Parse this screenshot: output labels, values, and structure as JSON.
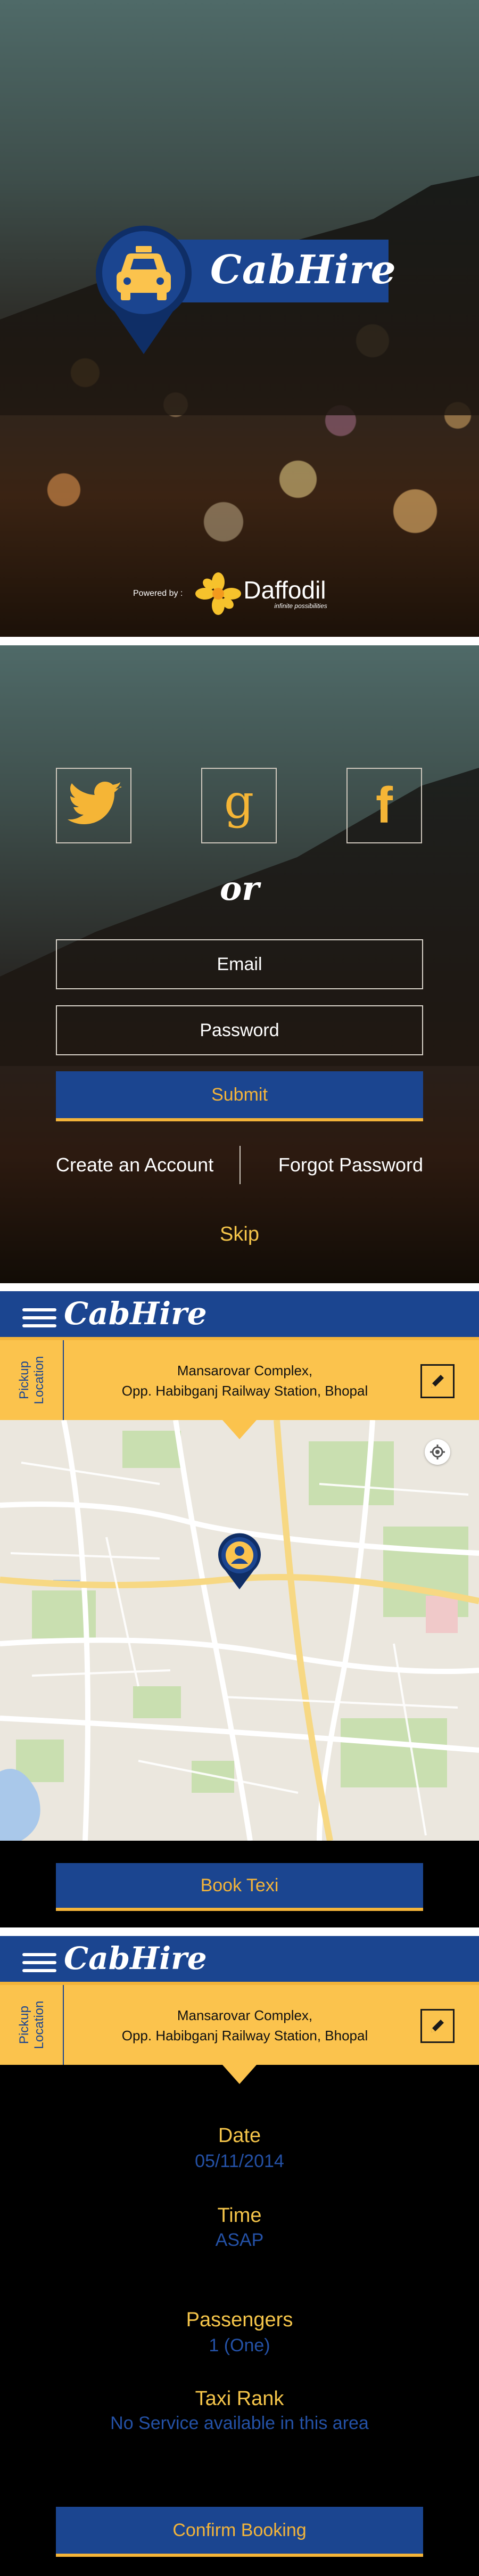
{
  "brand": {
    "app_name": "CabHire",
    "powered_by": "Powered by :",
    "company": "Daffodil",
    "company_tagline": "infinite possibilities"
  },
  "login": {
    "separator": "or",
    "email_placeholder": "Email",
    "password_placeholder": "Password",
    "submit_label": "Submit",
    "create_account": "Create an Account",
    "forgot_password": "Forgot Password",
    "skip": "Skip"
  },
  "pickup": {
    "side_label_line1": "Pickup",
    "side_label_line2": "Location",
    "address_line1": "Mansarovar Complex,",
    "address_line2": "Opp. Habibganj Railway Station, Bhopal"
  },
  "map_screen": {
    "book_label": "Book Texi"
  },
  "booking": {
    "date_label": "Date",
    "date_value": "05/11/2014",
    "time_label": "Time",
    "time_value": "ASAP",
    "passengers_label": "Passengers",
    "passengers_value": "1 (One)",
    "rank_label": "Taxi Rank",
    "rank_value": "No Service available in this area",
    "confirm_label": "Confirm Booking"
  },
  "colors": {
    "brand_blue": "#1b4590",
    "accent_yellow": "#fbc34d",
    "button_text": "#f3b43a"
  },
  "icons": [
    "taxi-icon",
    "twitter-icon",
    "google-icon",
    "facebook-icon",
    "hamburger-icon",
    "edit-icon",
    "location-pin-icon",
    "locate-me-icon"
  ]
}
